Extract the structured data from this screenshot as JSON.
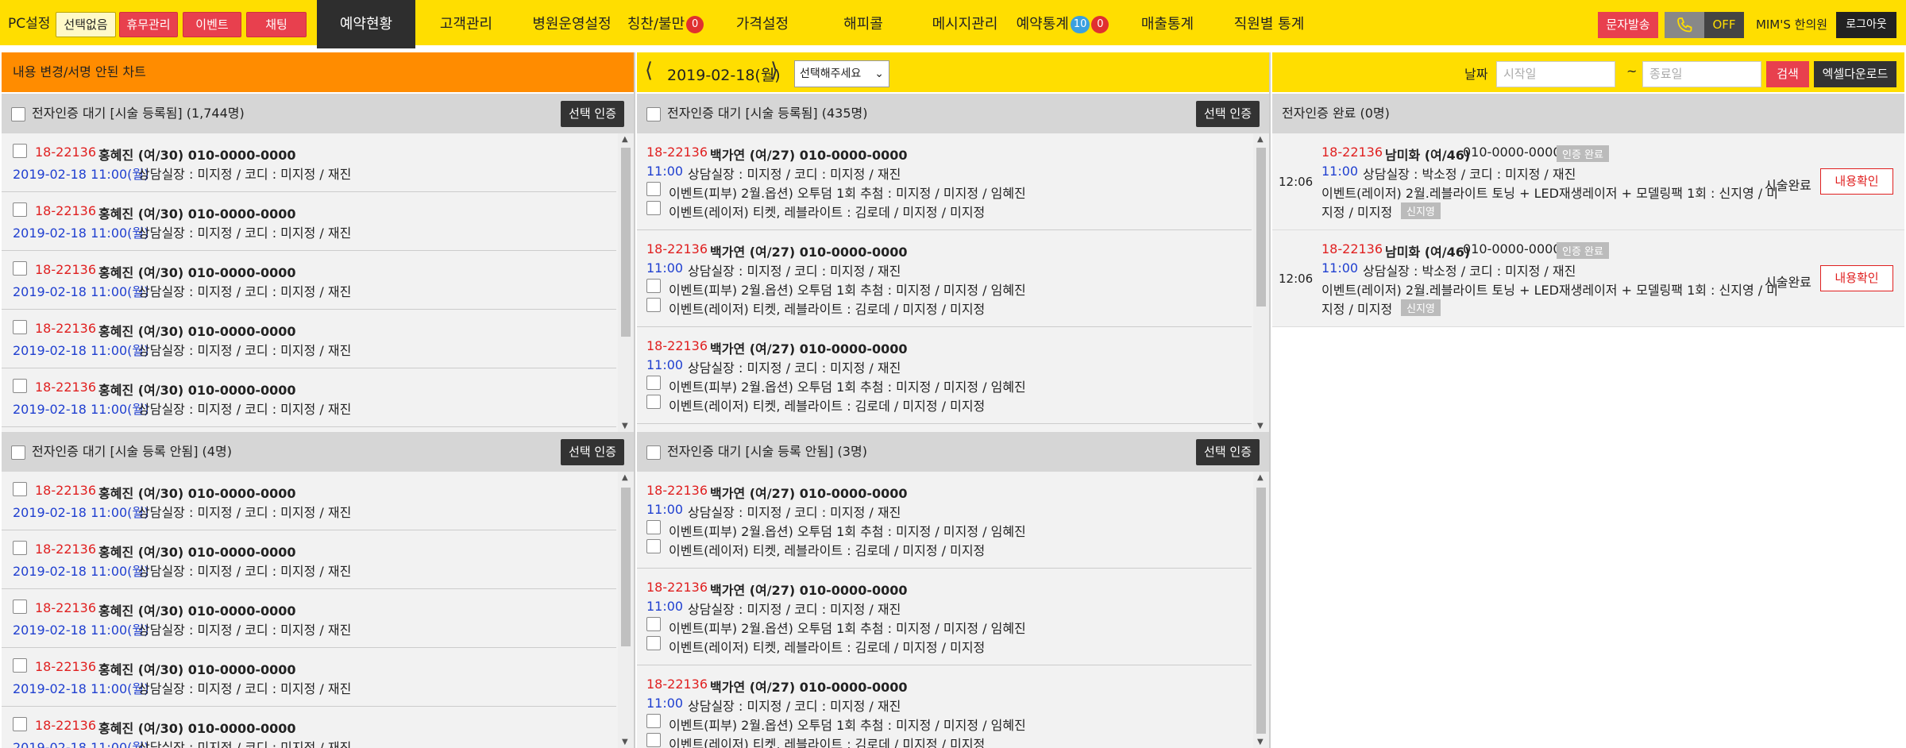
{
  "topbar": {
    "pcset": "PC설정",
    "none_btn": "선택없음",
    "holiday_btn": "휴무관리",
    "event_btn": "이벤트",
    "chat_btn": "채팅",
    "nav": [
      {
        "label": "예약현황",
        "active": true
      },
      {
        "label": "고객관리"
      },
      {
        "label": "병원운영설정"
      },
      {
        "label": "칭찬/불만",
        "badge": "0"
      },
      {
        "label": "가격설정"
      },
      {
        "label": "해피콜"
      },
      {
        "label": "메시지관리"
      },
      {
        "label": "예약통계",
        "badge": "10",
        "badge2": "0"
      },
      {
        "label": "매출통계"
      },
      {
        "label": "직원별 통계"
      }
    ],
    "sms_btn": "문자발송",
    "off_label": "OFF",
    "clinic_name": "MIM'S 한의원",
    "logout_btn": "로그아웃"
  },
  "col1": {
    "header": "내용 변경/서명 안된 차트",
    "sec1": {
      "title": "전자인증 대기 [시술 등록됨] (1,744명)",
      "btn": "선택 인증"
    },
    "sec2": {
      "title": "전자인증 대기 [시술 등록 안됨] (4명)",
      "btn": "선택 인증"
    },
    "item": {
      "chart": "18-22136",
      "patient": "홍혜진 (여/30) 010-0000-0000",
      "datetime": "2019-02-18 11:00(월)",
      "staff": "상담실장 : 미지정 / 코디 : 미지정 / 재진"
    }
  },
  "col2": {
    "date": "2019-02-18(월)",
    "select_placeholder": "선택해주세요",
    "sec1": {
      "title": "전자인증 대기 [시술 등록됨] (435명)",
      "btn": "선택 인증"
    },
    "sec2": {
      "title": "전자인증 대기 [시술 등록 안됨] (3명)",
      "btn": "선택 인증"
    },
    "item": {
      "chart": "18-22136",
      "patient": "백가연 (여/27) 010-0000-0000",
      "time": "11:00",
      "staff": "상담실장 : 미지정 / 코디 : 미지정 / 재진",
      "proc1": "이벤트(피부) 2월.옵션) 오투덤 1회 추첨 : 미지정 / 미지정 / 임혜진",
      "proc2": "이벤트(레이저) 티켓, 레블라이트 : 김로데 / 미지정 / 미지정"
    }
  },
  "col3": {
    "date_label": "날짜",
    "start_placeholder": "시작일",
    "tilde": "~",
    "end_placeholder": "종료일",
    "search_btn": "검색",
    "excel_btn": "엑셀다운로드",
    "sec": {
      "title": "전자인증 완료 (0명)"
    },
    "items": [
      {
        "time_left": "12:06",
        "chart": "18-22136",
        "patient": "남미화 (여/46)",
        "phone": "010-0000-0000",
        "tag": "인증 완료",
        "time": "11:00",
        "staff": "상담실장 : 박소정 / 코디 : 미지정 / 재진",
        "proc_a": "이벤트(레이저) 2월.레블라이트 토닝 + LED재생레이저 + 모델링팩 1회 : 신지영 / 미",
        "proc_b": "지정 / 미지정",
        "tag2": "신지영",
        "status": "시술완료",
        "btn": "내용확인"
      },
      {
        "time_left": "12:06",
        "chart": "18-22136",
        "patient": "남미화 (여/46)",
        "phone": "010-0000-0000",
        "tag": "인증 완료",
        "time": "11:00",
        "staff": "상담실장 : 박소정 / 코디 : 미지정 / 재진",
        "proc_a": "이벤트(레이저) 2월.레블라이트 토닝 + LED재생레이저 + 모델링팩 1회 : 신지영 / 미",
        "proc_b": "지정 / 미지정",
        "tag2": "신지영",
        "status": "시술완료",
        "btn": "내용확인"
      }
    ]
  },
  "colors": {
    "yellow": "#ffde00",
    "orange": "#ff8c00",
    "red": "#e8404e",
    "chart_red": "#e02020",
    "time_blue": "#1f3fd0",
    "dark": "#2e2e2e"
  }
}
